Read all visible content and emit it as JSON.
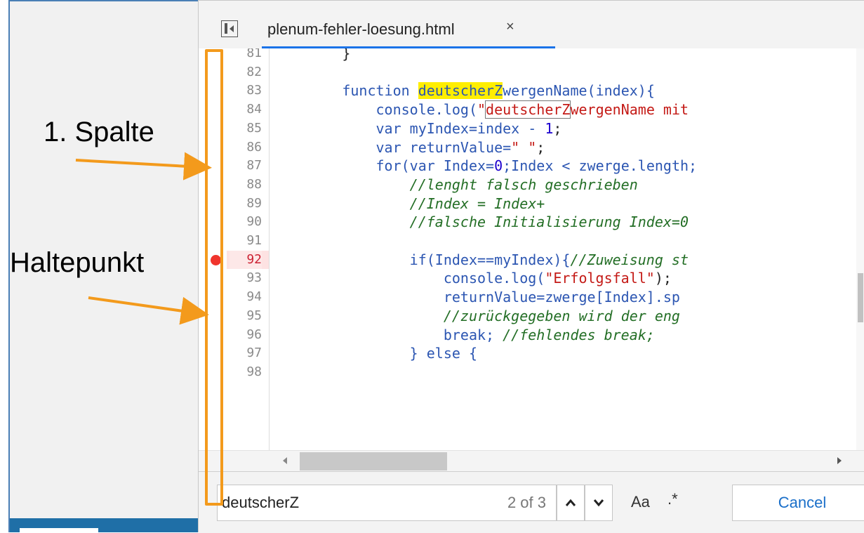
{
  "annotations": {
    "column_label": "1. Spalte",
    "breakpoint_label": "Haltepunkt",
    "accent_color": "#f39a1c"
  },
  "tab": {
    "filename": "plenum-fehler-loesung.html",
    "close_glyph": "×",
    "toggle_icon": "sidebar-toggle-icon"
  },
  "editor": {
    "breakpoint_line": "92",
    "lines": [
      {
        "n": "81",
        "tokens": [
          {
            "t": "        }",
            "c": "plain"
          }
        ]
      },
      {
        "n": "82",
        "tokens": []
      },
      {
        "n": "83",
        "tokens": [
          {
            "t": "        ",
            "c": "plain"
          },
          {
            "t": "function ",
            "c": "kw"
          },
          {
            "t": "deutscherZ",
            "c": "hl"
          },
          {
            "t": "wergenName(index){",
            "c": "kw"
          }
        ]
      },
      {
        "n": "84",
        "tokens": [
          {
            "t": "            console.log(",
            "c": "kw"
          },
          {
            "t": "\"",
            "c": "str"
          },
          {
            "t": "deutscherZ",
            "c": "strbox"
          },
          {
            "t": "wergenName mit",
            "c": "str"
          }
        ]
      },
      {
        "n": "85",
        "tokens": [
          {
            "t": "            ",
            "c": "plain"
          },
          {
            "t": "var ",
            "c": "kw"
          },
          {
            "t": "myIndex=index - ",
            "c": "kw"
          },
          {
            "t": "1",
            "c": "num"
          },
          {
            "t": ";",
            "c": "plain"
          }
        ]
      },
      {
        "n": "86",
        "tokens": [
          {
            "t": "            ",
            "c": "plain"
          },
          {
            "t": "var ",
            "c": "kw"
          },
          {
            "t": "returnValue=",
            "c": "kw"
          },
          {
            "t": "\" \"",
            "c": "str"
          },
          {
            "t": ";",
            "c": "plain"
          }
        ]
      },
      {
        "n": "87",
        "tokens": [
          {
            "t": "            for(",
            "c": "kw"
          },
          {
            "t": "var ",
            "c": "kw"
          },
          {
            "t": "Index=",
            "c": "kw"
          },
          {
            "t": "0",
            "c": "num"
          },
          {
            "t": ";Index < zwerge.length;",
            "c": "kw"
          }
        ]
      },
      {
        "n": "88",
        "tokens": [
          {
            "t": "                ",
            "c": "plain"
          },
          {
            "t": "//lenght falsch geschrieben",
            "c": "cmt"
          }
        ]
      },
      {
        "n": "89",
        "tokens": [
          {
            "t": "                ",
            "c": "plain"
          },
          {
            "t": "//Index = Index+",
            "c": "cmt"
          }
        ]
      },
      {
        "n": "90",
        "tokens": [
          {
            "t": "                ",
            "c": "plain"
          },
          {
            "t": "//falsche Initialisierung Index=0",
            "c": "cmt"
          }
        ]
      },
      {
        "n": "91",
        "tokens": []
      },
      {
        "n": "92",
        "tokens": [
          {
            "t": "                if(Index==myIndex){",
            "c": "kw"
          },
          {
            "t": "//Zuweisung st",
            "c": "cmt"
          }
        ]
      },
      {
        "n": "93",
        "tokens": [
          {
            "t": "                    console.log(",
            "c": "kw"
          },
          {
            "t": "\"Erfolgsfall\"",
            "c": "str"
          },
          {
            "t": ");",
            "c": "plain"
          }
        ]
      },
      {
        "n": "94",
        "tokens": [
          {
            "t": "                    returnValue=zwerge[Index].sp",
            "c": "kw"
          }
        ]
      },
      {
        "n": "95",
        "tokens": [
          {
            "t": "                    ",
            "c": "plain"
          },
          {
            "t": "//zurückgegeben wird der eng",
            "c": "cmt"
          }
        ]
      },
      {
        "n": "96",
        "tokens": [
          {
            "t": "                    break; ",
            "c": "kw"
          },
          {
            "t": "//fehlendes break;",
            "c": "cmt"
          }
        ]
      },
      {
        "n": "97",
        "tokens": [
          {
            "t": "                } else {",
            "c": "kw"
          }
        ]
      },
      {
        "n": "98",
        "tokens": []
      }
    ]
  },
  "search": {
    "query": "deutscherZ",
    "match_count": "2 of 3",
    "prev_glyph": "^",
    "next_glyph": "v",
    "match_case_label": "Aa",
    "regex_label": ".*",
    "cancel_label": "Cancel"
  }
}
